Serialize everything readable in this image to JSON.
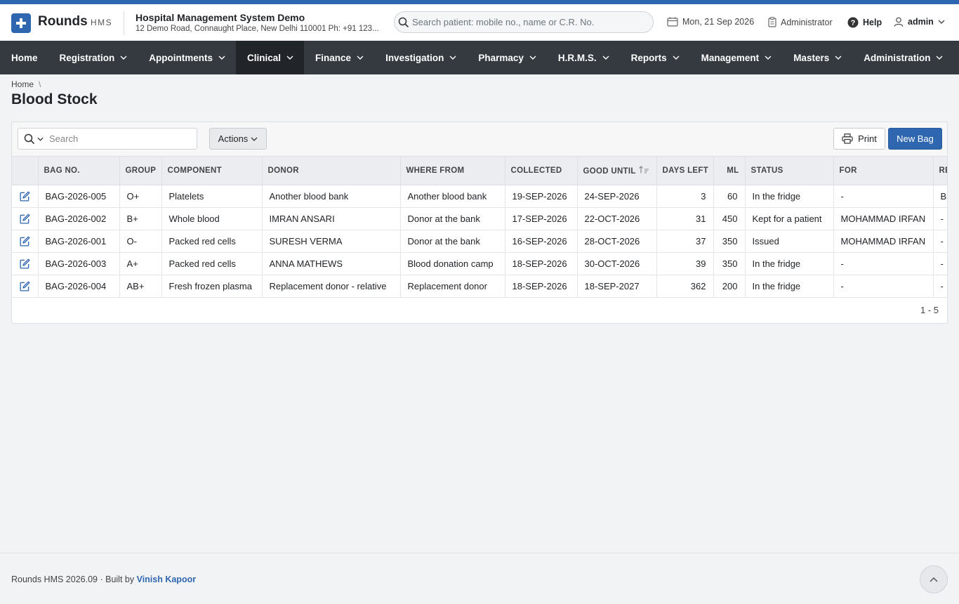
{
  "app": {
    "name": "Rounds",
    "suffix": "HMS"
  },
  "org": {
    "name": "Hospital Management System Demo",
    "address": "12 Demo Road, Connaught Place, New Delhi 110001 Ph: +91 123..."
  },
  "header": {
    "search_placeholder": "Search patient: mobile no., name or C.R. No.",
    "date": "Mon, 21 Sep 2026",
    "role": "Administrator",
    "help": "Help",
    "user": "admin"
  },
  "nav": [
    {
      "label": "Home",
      "dropdown": false
    },
    {
      "label": "Registration",
      "dropdown": true
    },
    {
      "label": "Appointments",
      "dropdown": true
    },
    {
      "label": "Clinical",
      "dropdown": true,
      "active": true
    },
    {
      "label": "Finance",
      "dropdown": true
    },
    {
      "label": "Investigation",
      "dropdown": true
    },
    {
      "label": "Pharmacy",
      "dropdown": true
    },
    {
      "label": "H.R.M.S.",
      "dropdown": true
    },
    {
      "label": "Reports",
      "dropdown": true
    },
    {
      "label": "Management",
      "dropdown": true
    },
    {
      "label": "Masters",
      "dropdown": true
    },
    {
      "label": "Administration",
      "dropdown": true
    }
  ],
  "breadcrumb": {
    "home": "Home",
    "sep": "\\"
  },
  "page": {
    "title": "Blood Stock"
  },
  "toolbar": {
    "search_placeholder": "Search",
    "actions": "Actions",
    "print": "Print",
    "new": "New Bag"
  },
  "table": {
    "columns": [
      "Bag No.",
      "Group",
      "Component",
      "Donor",
      "Where From",
      "Collected",
      "Good Until",
      "Days Left",
      "ML",
      "Status",
      "For",
      "Re"
    ],
    "rows": [
      [
        "BAG-2026-005",
        "O+",
        "Platelets",
        "Another blood bank",
        "Another blood bank",
        "19-SEP-2026",
        "24-SEP-2026",
        "3",
        "60",
        "In the fridge",
        "-",
        "Br"
      ],
      [
        "BAG-2026-002",
        "B+",
        "Whole blood",
        "IMRAN ANSARI",
        "Donor at the bank",
        "17-SEP-2026",
        "22-OCT-2026",
        "31",
        "450",
        "Kept for a patient",
        "MOHAMMAD IRFAN",
        "-"
      ],
      [
        "BAG-2026-001",
        "O-",
        "Packed red cells",
        "SURESH VERMA",
        "Donor at the bank",
        "16-SEP-2026",
        "28-OCT-2026",
        "37",
        "350",
        "Issued",
        "MOHAMMAD IRFAN",
        "-"
      ],
      [
        "BAG-2026-003",
        "A+",
        "Packed red cells",
        "ANNA MATHEWS",
        "Blood donation camp",
        "18-SEP-2026",
        "30-OCT-2026",
        "39",
        "350",
        "In the fridge",
        "-",
        "-"
      ],
      [
        "BAG-2026-004",
        "AB+",
        "Fresh frozen plasma",
        "Replacement donor - relative",
        "Replacement donor",
        "18-SEP-2026",
        "18-SEP-2027",
        "362",
        "200",
        "In the fridge",
        "-",
        "-"
      ]
    ]
  },
  "pager": "1 - 5",
  "footer": {
    "text": "Rounds HMS 2026.09 · Built by",
    "author": "Vinish Kapoor"
  },
  "colors": {
    "brand": "#2f66b0",
    "nav_bg": "#343a40",
    "nav_active": "#212529"
  }
}
